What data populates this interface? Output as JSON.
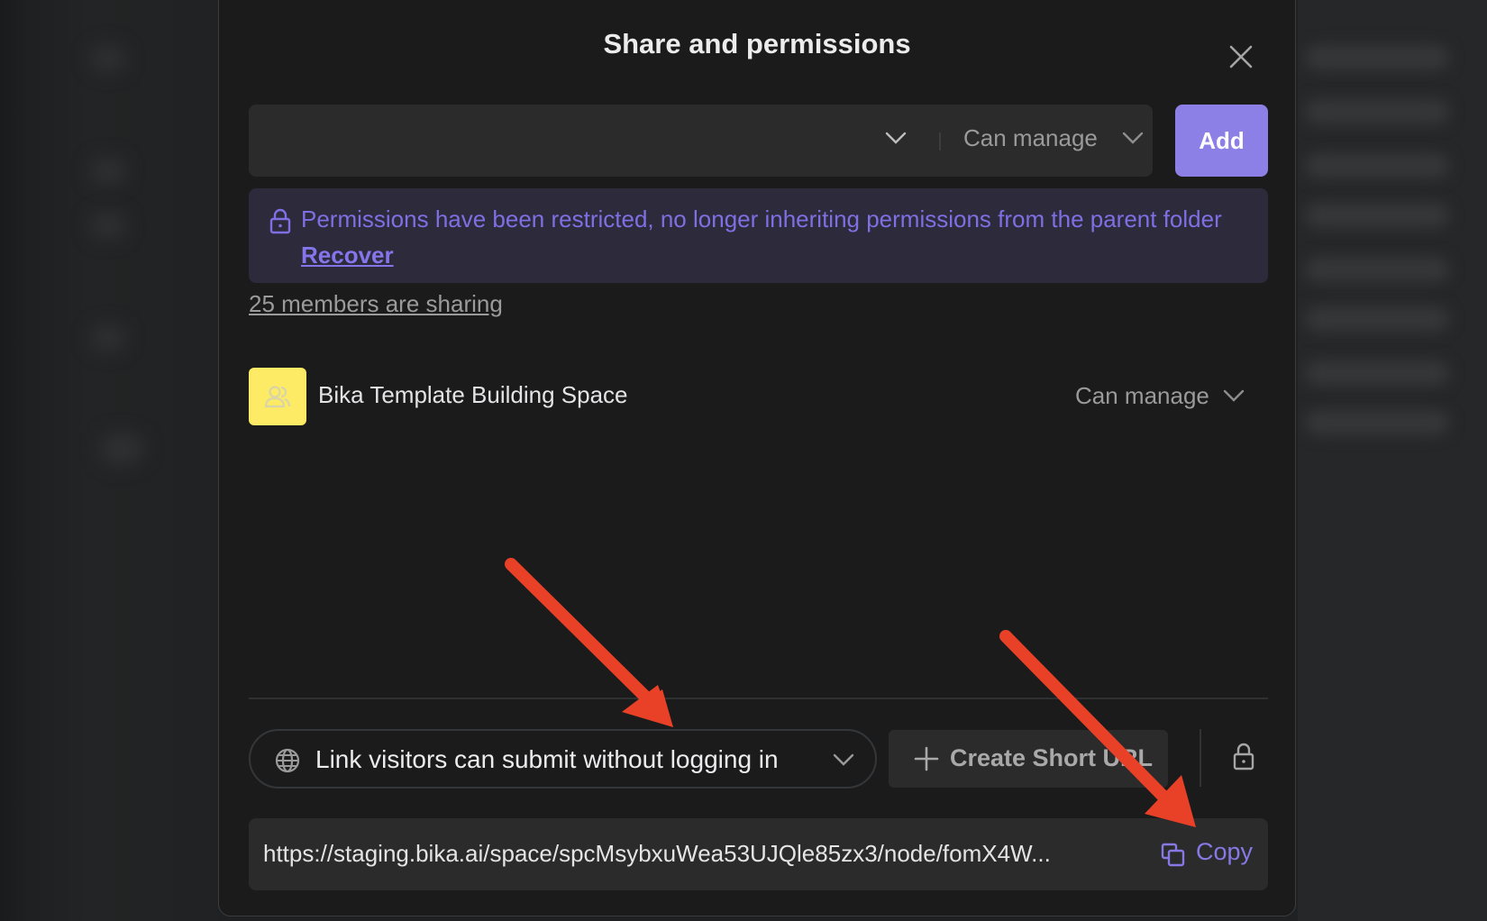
{
  "modal": {
    "title": "Share and permissions",
    "close_icon": "close-icon"
  },
  "member_picker": {
    "value": "",
    "role_selected": "Can manage",
    "add_label": "Add"
  },
  "banner": {
    "icon": "lock-icon",
    "message": "Permissions have been restricted, no longer inheriting permissions from the parent folder",
    "action_label": "Recover"
  },
  "members": {
    "summary": "25 members are sharing",
    "list": [
      {
        "name": "Bika Template Building Space",
        "avatar_icon": "users-icon",
        "avatar_color": "#fdea65",
        "role": "Can manage"
      }
    ]
  },
  "link_sharing": {
    "access_mode": "Link visitors can submit without logging in",
    "create_short_url_label": "Create Short URL",
    "lock_icon": "lock-icon",
    "url": "https://staging.bika.ai/space/spcMsybxuWea53UJQle85zx3/node/fomX4W...",
    "copy_label": "Copy"
  },
  "colors": {
    "accent": "#8c7fe6",
    "banner_text": "#7e6fe3",
    "annotation_arrow": "#e84127"
  },
  "annotations": [
    {
      "type": "arrow",
      "target": "link-access-dropdown"
    },
    {
      "type": "arrow",
      "target": "copy-button"
    }
  ]
}
